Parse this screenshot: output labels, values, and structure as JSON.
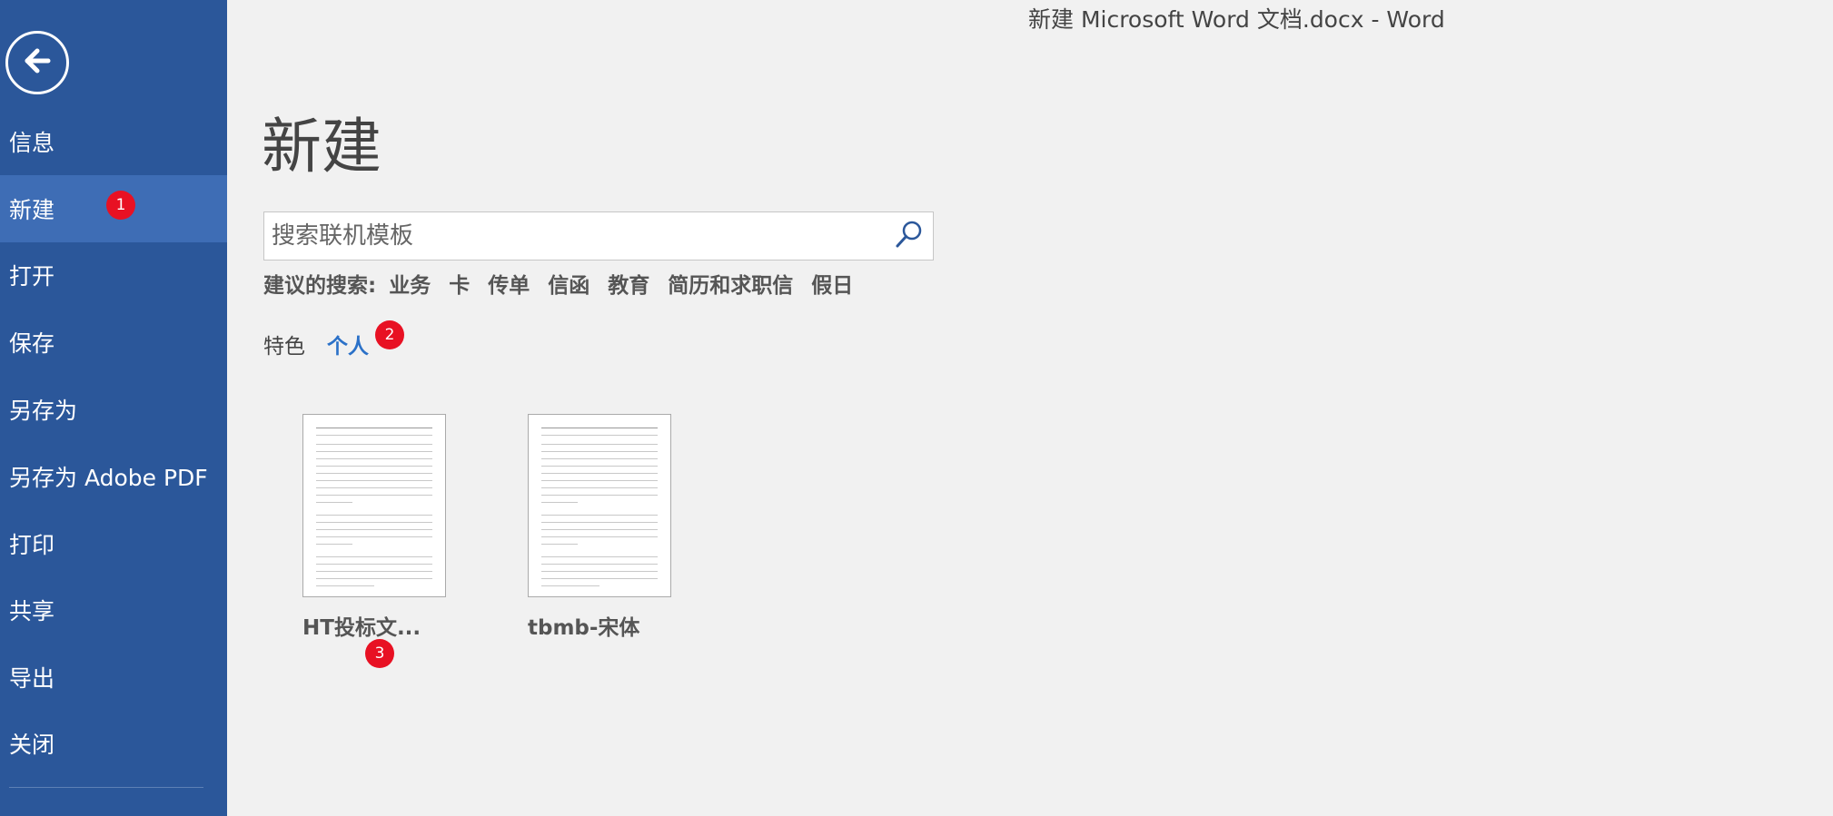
{
  "window": {
    "title": "新建 Microsoft Word 文档.docx - Word"
  },
  "sidebar": {
    "items": [
      {
        "label": "信息",
        "active": false
      },
      {
        "label": "新建",
        "active": true
      },
      {
        "label": "打开",
        "active": false
      },
      {
        "label": "保存",
        "active": false
      },
      {
        "label": "另存为",
        "active": false
      },
      {
        "label": "另存为 Adobe PDF",
        "active": false
      },
      {
        "label": "打印",
        "active": false
      },
      {
        "label": "共享",
        "active": false
      },
      {
        "label": "导出",
        "active": false
      },
      {
        "label": "关闭",
        "active": false
      }
    ]
  },
  "main": {
    "title": "新建",
    "search": {
      "placeholder": "搜索联机模板",
      "value": ""
    },
    "suggestions": {
      "label": "建议的搜索:",
      "items": [
        "业务",
        "卡",
        "传单",
        "信函",
        "教育",
        "简历和求职信",
        "假日"
      ]
    },
    "tabs": [
      {
        "label": "特色",
        "active": false
      },
      {
        "label": "个人",
        "active": true
      }
    ],
    "templates": [
      {
        "name": "HT投标文..."
      },
      {
        "name": "tbmb-宋体"
      }
    ]
  },
  "annotations": [
    {
      "label": "1"
    },
    {
      "label": "2"
    },
    {
      "label": "3"
    }
  ],
  "colors": {
    "sidebar": "#2b579a",
    "sidebar_active": "#3e6db5",
    "background": "#f1f1f1",
    "accent_tab": "#2b71c8",
    "badge": "#e81123"
  },
  "icons": {
    "back": "back-arrow-icon",
    "search": "search-icon"
  }
}
